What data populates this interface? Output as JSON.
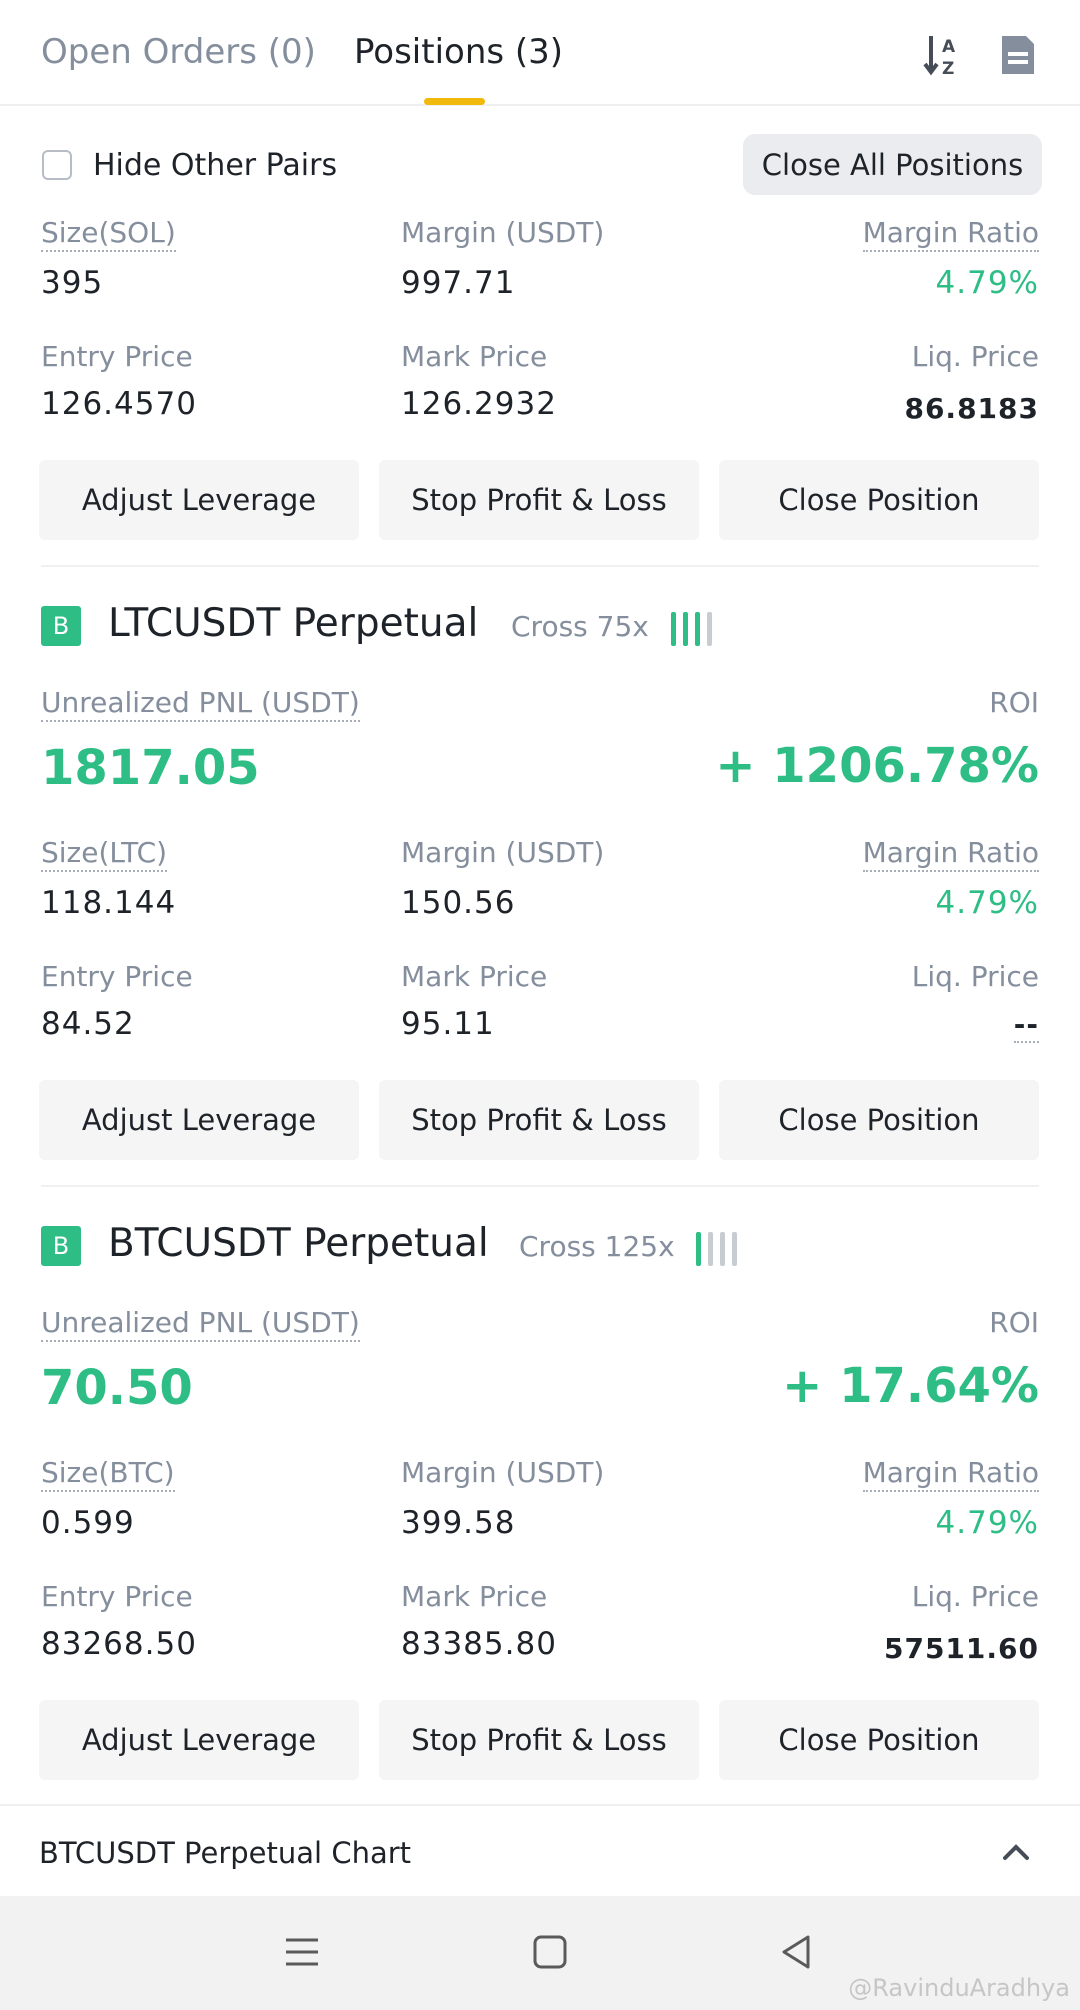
{
  "tabs": {
    "open_orders": "Open Orders (0)",
    "positions": "Positions (3)"
  },
  "header_icons": {
    "sort": "sort-az-icon",
    "document": "document-icon"
  },
  "filter": {
    "hide_other_pairs": "Hide Other Pairs",
    "close_all": "Close All Positions"
  },
  "sol": {
    "size_label": "Size(SOL)",
    "size": "395",
    "margin_label": "Margin (USDT)",
    "margin": "997.71",
    "ratio_label": "Margin Ratio",
    "ratio": "4.79%",
    "entry_label": "Entry Price",
    "entry": "126.4570",
    "mark_label": "Mark Price",
    "mark": "126.2932",
    "liq_label": "Liq. Price",
    "liq": "86.8183"
  },
  "ltc": {
    "badge": "B",
    "symbol": "LTCUSDT Perpetual",
    "leverage": "Cross 75x",
    "signal_level": 3,
    "pnl_label": "Unrealized PNL (USDT)",
    "pnl": "1817.05",
    "roi_label": "ROI",
    "roi": "+ 1206.78%",
    "size_label": "Size(LTC)",
    "size": "118.144",
    "margin_label": "Margin (USDT)",
    "margin": "150.56",
    "ratio_label": "Margin Ratio",
    "ratio": "4.79%",
    "entry_label": "Entry Price",
    "entry": "84.52",
    "mark_label": "Mark Price",
    "mark": "95.11",
    "liq_label": "Liq. Price",
    "liq": "--"
  },
  "btc": {
    "badge": "B",
    "symbol": "BTCUSDT Perpetual",
    "leverage": "Cross 125x",
    "signal_level": 1,
    "pnl_label": "Unrealized PNL (USDT)",
    "pnl": "70.50",
    "roi_label": "ROI",
    "roi": "+ 17.64%",
    "size_label": "Size(BTC)",
    "size": "0.599",
    "margin_label": "Margin (USDT)",
    "margin": "399.58",
    "ratio_label": "Margin Ratio",
    "ratio": "4.79%",
    "entry_label": "Entry Price",
    "entry": "83268.50",
    "mark_label": "Mark Price",
    "mark": "83385.80",
    "liq_label": "Liq. Price",
    "liq": "57511.60"
  },
  "buttons": {
    "adjust": "Adjust Leverage",
    "stop": "Stop Profit & Loss",
    "close": "Close Position"
  },
  "chart": {
    "label": "BTCUSDT Perpetual  Chart"
  },
  "watermark": "@RavinduAradhya",
  "colors": {
    "profit": "#2ebd85",
    "accent": "#f0b90b",
    "text": "#1e2329",
    "muted": "#848e9c"
  }
}
